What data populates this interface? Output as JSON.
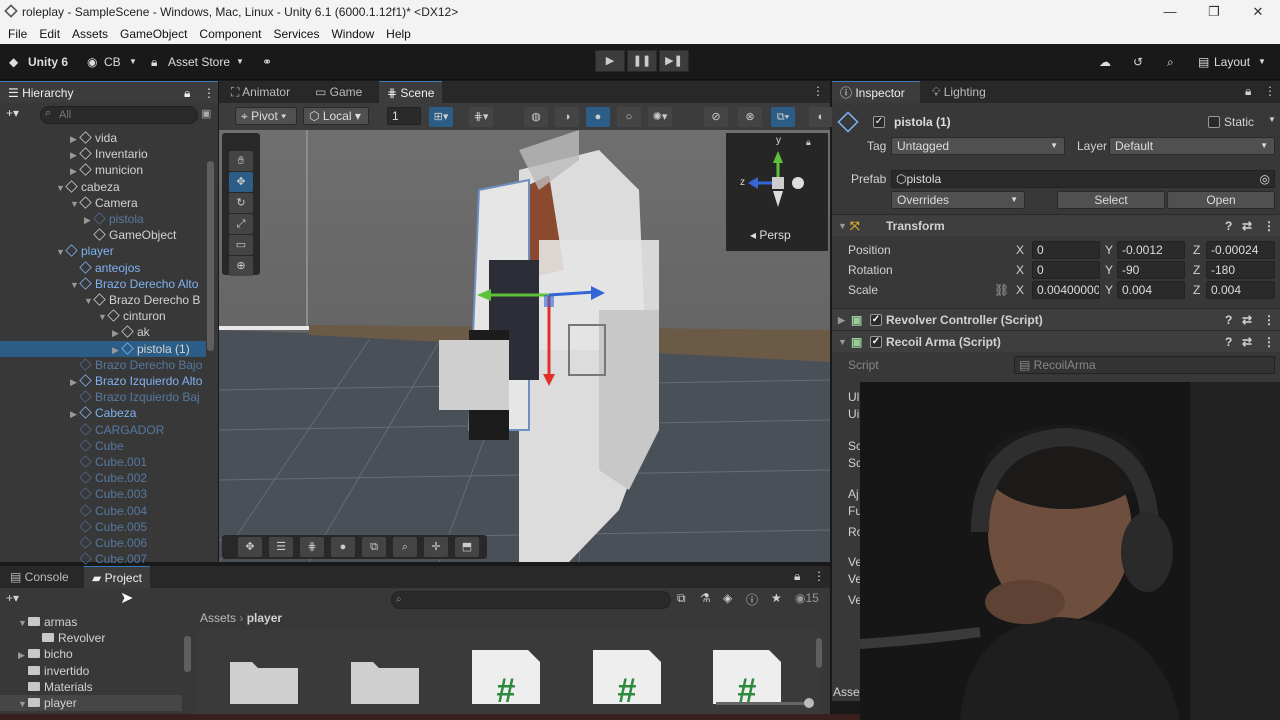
{
  "window": {
    "title": "roleplay - SampleScene - Windows, Mac, Linux - Unity 6.1 (6000.1.12f1)* <DX12>"
  },
  "menu": [
    "File",
    "Edit",
    "Assets",
    "GameObject",
    "Component",
    "Services",
    "Window",
    "Help"
  ],
  "toolbar": {
    "unity": "Unity 6",
    "account": "CB",
    "asset_store": "Asset Store",
    "layout": "Layout"
  },
  "hierarchy": {
    "tab": "Hierarchy",
    "search_placeholder": "All",
    "rows": [
      {
        "label": "vida",
        "indent": 5,
        "style": "normal",
        "arrow": "▶"
      },
      {
        "label": "Inventario",
        "indent": 5,
        "style": "normal",
        "arrow": "▶"
      },
      {
        "label": "municion",
        "indent": 5,
        "style": "normal",
        "arrow": "▶"
      },
      {
        "label": "cabeza",
        "indent": 4,
        "style": "normal",
        "arrow": "▼"
      },
      {
        "label": "Camera",
        "indent": 5,
        "style": "normal",
        "arrow": "▼"
      },
      {
        "label": "pistola",
        "indent": 6,
        "style": "faded",
        "arrow": "▶"
      },
      {
        "label": "GameObject",
        "indent": 6,
        "style": "normal",
        "arrow": ""
      },
      {
        "label": "player",
        "indent": 4,
        "style": "blue",
        "arrow": "▼"
      },
      {
        "label": "anteojos",
        "indent": 5,
        "style": "blue",
        "arrow": ""
      },
      {
        "label": "Brazo Derecho Alto",
        "indent": 5,
        "style": "blue",
        "arrow": "▼"
      },
      {
        "label": "Brazo Derecho B",
        "indent": 6,
        "style": "normal",
        "arrow": "▼"
      },
      {
        "label": "cinturon",
        "indent": 7,
        "style": "normal",
        "arrow": "▼"
      },
      {
        "label": "ak",
        "indent": 8,
        "style": "normal",
        "arrow": "▶"
      },
      {
        "label": "pistola (1)",
        "indent": 8,
        "style": "selected",
        "arrow": "▶"
      },
      {
        "label": "Brazo Derecho Bajo",
        "indent": 5,
        "style": "faded",
        "arrow": ""
      },
      {
        "label": "Brazo Izquierdo Alto",
        "indent": 5,
        "style": "blue",
        "arrow": "▶"
      },
      {
        "label": "Brazo Izquierdo Baj",
        "indent": 5,
        "style": "faded",
        "arrow": ""
      },
      {
        "label": "Cabeza",
        "indent": 5,
        "style": "blue",
        "arrow": "▶"
      },
      {
        "label": "CARGADOR",
        "indent": 5,
        "style": "faded",
        "arrow": ""
      },
      {
        "label": "Cube",
        "indent": 5,
        "style": "faded",
        "arrow": ""
      },
      {
        "label": "Cube.001",
        "indent": 5,
        "style": "faded",
        "arrow": ""
      },
      {
        "label": "Cube.002",
        "indent": 5,
        "style": "faded",
        "arrow": ""
      },
      {
        "label": "Cube.003",
        "indent": 5,
        "style": "faded",
        "arrow": ""
      },
      {
        "label": "Cube.004",
        "indent": 5,
        "style": "faded",
        "arrow": ""
      },
      {
        "label": "Cube.005",
        "indent": 5,
        "style": "faded",
        "arrow": ""
      },
      {
        "label": "Cube.006",
        "indent": 5,
        "style": "faded",
        "arrow": ""
      },
      {
        "label": "Cube.007",
        "indent": 5,
        "style": "faded",
        "arrow": ""
      }
    ]
  },
  "scene_tabs": [
    "Animator",
    "Game",
    "Scene"
  ],
  "scene_toolbar": {
    "pivot": "Pivot",
    "local": "Local",
    "grid": "1"
  },
  "gizmo": {
    "label": "Persp"
  },
  "inspector": {
    "tabs": [
      "Inspector",
      "Lighting"
    ],
    "object_name": "pistola (1)",
    "static": "Static",
    "tag_label": "Tag",
    "tag": "Untagged",
    "layer_label": "Layer",
    "layer": "Default",
    "prefab_label": "Prefab",
    "prefab": "pistola",
    "overrides": "Overrides",
    "select": "Select",
    "open": "Open",
    "transform": "Transform",
    "position": {
      "label": "Position",
      "x": "0",
      "y": "-0.0012",
      "z": "-0.00024"
    },
    "rotation": {
      "label": "Rotation",
      "x": "0",
      "y": "-90",
      "z": "-180"
    },
    "scale": {
      "label": "Scale",
      "x": "0.00400000",
      "y": "0.004",
      "z": "0.004"
    },
    "components": [
      "Revolver Controller (Script)",
      "Recoil Arma (Script)"
    ],
    "script_label": "Script",
    "script": "RecoilArma",
    "partial_labels": [
      "Ul",
      "Ui",
      "Sc",
      "Sc",
      "Aj",
      "Fu",
      "Ro",
      "Ve",
      "Ve",
      "Ve"
    ],
    "bottom_label": "Asse"
  },
  "bottom": {
    "tabs": [
      "Console",
      "Project"
    ],
    "badge": "15",
    "folders": [
      {
        "label": "armas",
        "indent": 1,
        "arrow": "▼"
      },
      {
        "label": "Revolver",
        "indent": 2,
        "arrow": ""
      },
      {
        "label": "bicho",
        "indent": 1,
        "arrow": "▶"
      },
      {
        "label": "invertido",
        "indent": 1,
        "arrow": ""
      },
      {
        "label": "Materials",
        "indent": 1,
        "arrow": ""
      },
      {
        "label": "player",
        "indent": 1,
        "arrow": "▼"
      }
    ],
    "breadcrumb": [
      "Assets",
      "player"
    ]
  },
  "colors": {
    "accent": "#3a79bb",
    "x_axis": "#e0302a",
    "y_axis": "#5ec13a",
    "z_axis": "#3466d6"
  }
}
